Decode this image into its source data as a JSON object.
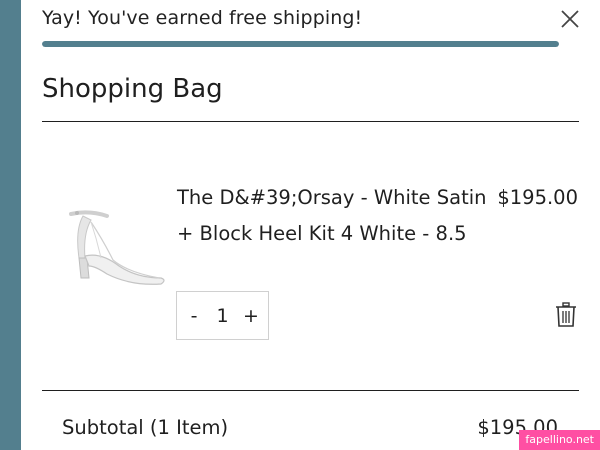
{
  "banner": {
    "message": "Yay! You've earned free shipping!",
    "close_icon": "close-icon",
    "progress_percent": 100
  },
  "bag": {
    "title": "Shopping Bag"
  },
  "item": {
    "name": "The D&#39;Orsay - White Satin + Block Heel Kit 4 White - 8.5",
    "price": "$195.00",
    "image_icon": "shoe-product-image",
    "quantity": "1",
    "minus_label": "-",
    "plus_label": "+",
    "remove_icon": "trash-icon"
  },
  "summary": {
    "subtotal_label": "Subtotal (1 Item)",
    "subtotal_value": "$195.00"
  },
  "watermark": "fapellino.net",
  "colors": {
    "accent": "#537f8e",
    "text": "#1f1f1f",
    "watermark_bg": "#ff4fa3"
  }
}
